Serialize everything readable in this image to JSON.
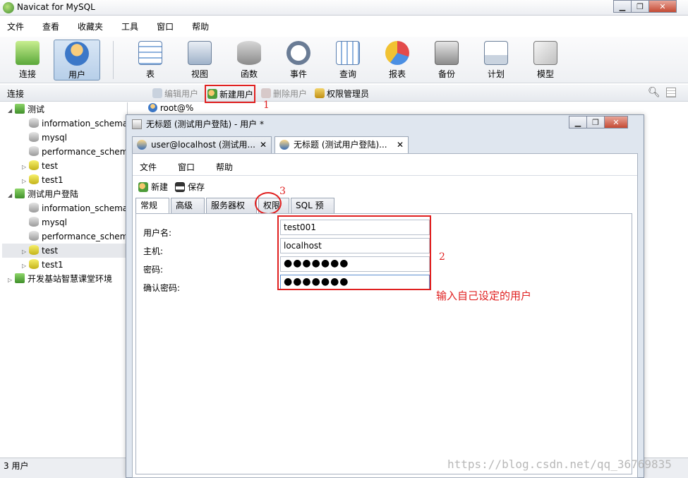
{
  "app": {
    "title": "Navicat for MySQL"
  },
  "menubar": [
    "文件",
    "查看",
    "收藏夹",
    "工具",
    "窗口",
    "帮助"
  ],
  "toolbar": [
    {
      "label": "连接",
      "icon": "connection-icon"
    },
    {
      "label": "用户",
      "icon": "user-icon"
    },
    {
      "label": "表",
      "icon": "table-icon"
    },
    {
      "label": "视图",
      "icon": "view-icon"
    },
    {
      "label": "函数",
      "icon": "function-icon"
    },
    {
      "label": "事件",
      "icon": "event-icon"
    },
    {
      "label": "查询",
      "icon": "query-icon"
    },
    {
      "label": "报表",
      "icon": "report-icon"
    },
    {
      "label": "备份",
      "icon": "backup-icon"
    },
    {
      "label": "计划",
      "icon": "schedule-icon"
    },
    {
      "label": "模型",
      "icon": "model-icon"
    }
  ],
  "subbar": {
    "conn_label": "连接",
    "edit_user": "编辑用户",
    "new_user": "新建用户",
    "delete_user": "删除用户",
    "privilege_manager": "权限管理员"
  },
  "tree": [
    {
      "label": "测试",
      "type": "conn",
      "level": 0,
      "twisty": "◢"
    },
    {
      "label": "information_schema",
      "type": "db",
      "level": 1
    },
    {
      "label": "mysql",
      "type": "db",
      "level": 1
    },
    {
      "label": "performance_schema",
      "type": "db",
      "level": 1
    },
    {
      "label": "test",
      "type": "dbg",
      "level": 1,
      "twisty": "▷"
    },
    {
      "label": "test1",
      "type": "dbg",
      "level": 1,
      "twisty": "▷"
    },
    {
      "label": "测试用户登陆",
      "type": "conn",
      "level": 0,
      "twisty": "◢"
    },
    {
      "label": "information_schema",
      "type": "db",
      "level": 1
    },
    {
      "label": "mysql",
      "type": "db",
      "level": 1
    },
    {
      "label": "performance_schema",
      "type": "db",
      "level": 1
    },
    {
      "label": "test",
      "type": "dbg",
      "level": 1,
      "twisty": "▷",
      "selected": true
    },
    {
      "label": "test1",
      "type": "dbg",
      "level": 1,
      "twisty": "▷"
    },
    {
      "label": "开发基站智慧课堂环境",
      "type": "conn",
      "level": 0,
      "twisty": "▷"
    }
  ],
  "userlist": {
    "item": "root@%"
  },
  "status": {
    "text": "3 用户"
  },
  "child": {
    "title": "无标题 (测试用户登陆) - 用户 *",
    "tabs": [
      {
        "label": "user@localhost (测试用..."
      },
      {
        "label": "无标题 (测试用户登陆)..."
      }
    ],
    "menu": [
      "文件",
      "窗口",
      "帮助"
    ],
    "toolbar": {
      "new": "新建",
      "save": "保存"
    },
    "prop_tabs": [
      "常规",
      "高级",
      "服务器权限",
      "权限",
      "SQL 预览"
    ],
    "form": {
      "username_label": "用户名:",
      "host_label": "主机:",
      "password_label": "密码:",
      "confirm_label": "确认密码:",
      "username": "test001",
      "host": "localhost",
      "password": "●●●●●●●",
      "confirm": "●●●●●●●"
    }
  },
  "annotations": {
    "n1": "1",
    "n2": "2",
    "n3": "3",
    "hint": "输入自己设定的用户"
  },
  "watermark": "https://blog.csdn.net/qq_36769835",
  "colors": {
    "annotation": "#e02020",
    "accent": "#6f8fb3"
  }
}
